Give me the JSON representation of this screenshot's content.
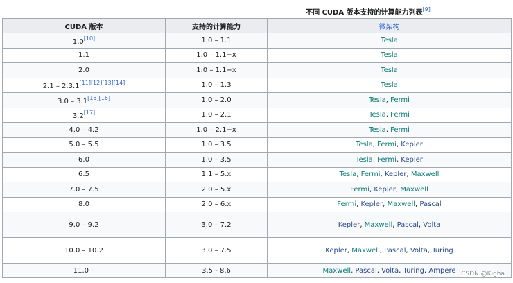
{
  "caption": {
    "text": "不同 CUDA 版本支持的计算能力列表",
    "ref": "[9]"
  },
  "headers": {
    "version": "CUDA 版本",
    "capability": "支持的计算能力",
    "arch": "微架构"
  },
  "rows": [
    {
      "version": "1.0",
      "refs": "[10]",
      "capability": "1.0 – 1.1",
      "archs": [
        "Tesla"
      ]
    },
    {
      "version": "1.1",
      "refs": "",
      "capability": "1.0 – 1.1+x",
      "archs": [
        "Tesla"
      ]
    },
    {
      "version": "2.0",
      "refs": "",
      "capability": "1.0 – 1.1+x",
      "archs": [
        "Tesla"
      ]
    },
    {
      "version": "2.1 – 2.3.1",
      "refs": "[11][12][13][14]",
      "capability": "1.0 – 1.3",
      "archs": [
        "Tesla"
      ]
    },
    {
      "version": "3.0 – 3.1",
      "refs": "[15][16]",
      "capability": "1.0 – 2.0",
      "archs": [
        "Tesla",
        "Fermi"
      ]
    },
    {
      "version": "3.2",
      "refs": "[17]",
      "capability": "1.0 – 2.1",
      "archs": [
        "Tesla",
        "Fermi"
      ]
    },
    {
      "version": "4.0 – 4.2",
      "refs": "",
      "capability": "1.0 – 2.1+x",
      "archs": [
        "Tesla",
        "Fermi"
      ]
    },
    {
      "version": "5.0 – 5.5",
      "refs": "",
      "capability": "1.0 – 3.5",
      "archs": [
        "Tesla",
        "Fermi",
        "Kepler"
      ]
    },
    {
      "version": "6.0",
      "refs": "",
      "capability": "1.0 – 3.5",
      "archs": [
        "Tesla",
        "Fermi",
        "Kepler"
      ]
    },
    {
      "version": "6.5",
      "refs": "",
      "capability": "1.1 – 5.x",
      "archs": [
        "Tesla",
        "Fermi",
        "Kepler",
        "Maxwell"
      ]
    },
    {
      "version": "7.0 – 7.5",
      "refs": "",
      "capability": "2.0 – 5.x",
      "archs": [
        "Fermi",
        "Kepler",
        "Maxwell"
      ]
    },
    {
      "version": "8.0",
      "refs": "",
      "capability": "2.0 – 6.x",
      "archs": [
        "Fermi",
        "Kepler",
        "Maxwell",
        "Pascal"
      ]
    },
    {
      "version": "9.0 – 9.2",
      "refs": "",
      "capability": "3.0 – 7.2",
      "archs": [
        "Kepler",
        "Maxwell",
        "Pascal",
        "Volta"
      ]
    },
    {
      "version": "10.0 – 10.2",
      "refs": "",
      "capability": "3.0 – 7.5",
      "archs": [
        "Kepler",
        "Maxwell",
        "Pascal",
        "Volta",
        "Turing"
      ]
    },
    {
      "version": "11.0 –",
      "refs": "",
      "capability": "3.5 - 8.6",
      "archs": [
        "Maxwell",
        "Pascal",
        "Volta",
        "Turing",
        "Ampere"
      ]
    }
  ],
  "arch_colors": {
    "Tesla": "#0b7a75",
    "Fermi": "#0b7a75",
    "Kepler": "#2a4b8d",
    "Maxwell": "#0b7a75",
    "Pascal": "#2a4b8d",
    "Volta": "#2a4b8d",
    "Turing": "#2a4b8d",
    "Ampere": "#2a4b8d"
  },
  "watermark": "CSDN @Kigha"
}
